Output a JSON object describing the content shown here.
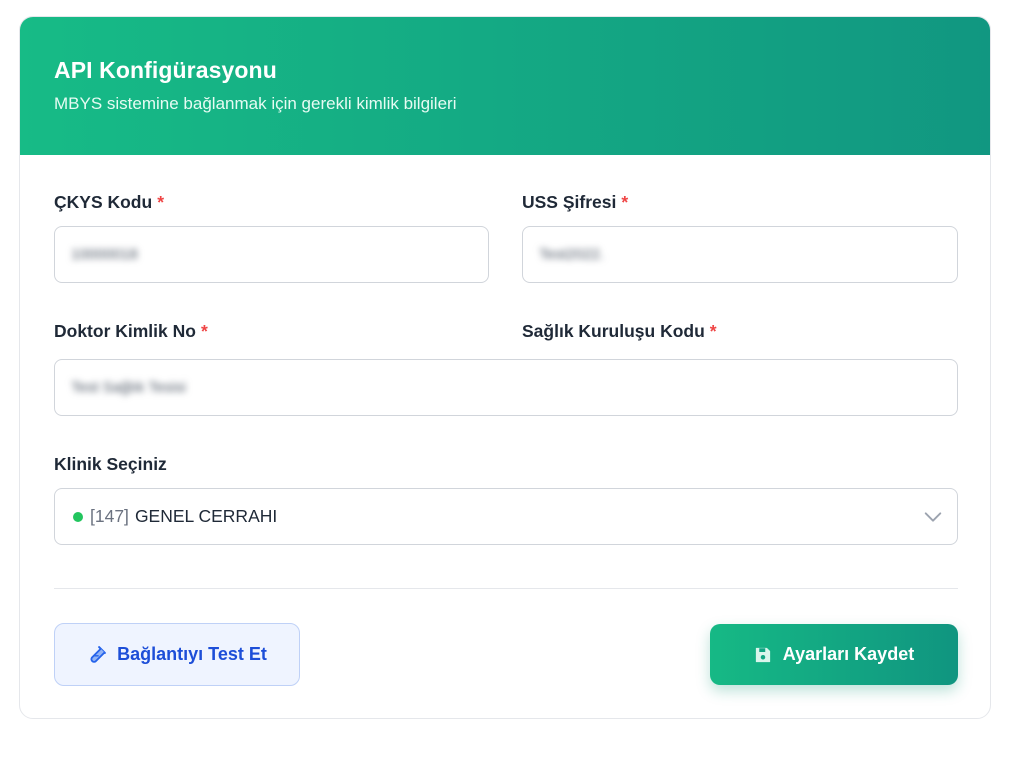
{
  "header": {
    "title": "API Konfigürasyonu",
    "subtitle": "MBYS sistemine bağlanmak için gerekli kimlik bilgileri"
  },
  "form": {
    "required_marker": "*",
    "ckys_code": {
      "label": "ÇKYS Kodu",
      "value": "10000018"
    },
    "uss_password": {
      "label": "USS Şifresi",
      "value": "Test2022."
    },
    "doctor_id": {
      "label": "Doktor Kimlik No"
    },
    "health_facility_code": {
      "label": "Sağlık Kuruluşu Kodu",
      "value": "Test Sağlık Tesisi"
    },
    "clinic": {
      "label": "Klinik Seçiniz",
      "selected_code": "[147]",
      "selected_name": "GENEL CERRAHI",
      "status_color": "#22c55e"
    }
  },
  "actions": {
    "test_label": "Bağlantıyı Test Et",
    "test_icon": "test-tube-icon",
    "save_label": "Ayarları Kaydet",
    "save_icon": "floppy-disk-icon"
  },
  "colors": {
    "brand_start": "#17bb86",
    "brand_end": "#119781",
    "required": "#ef4444",
    "test_accent": "#1d4ed8"
  }
}
